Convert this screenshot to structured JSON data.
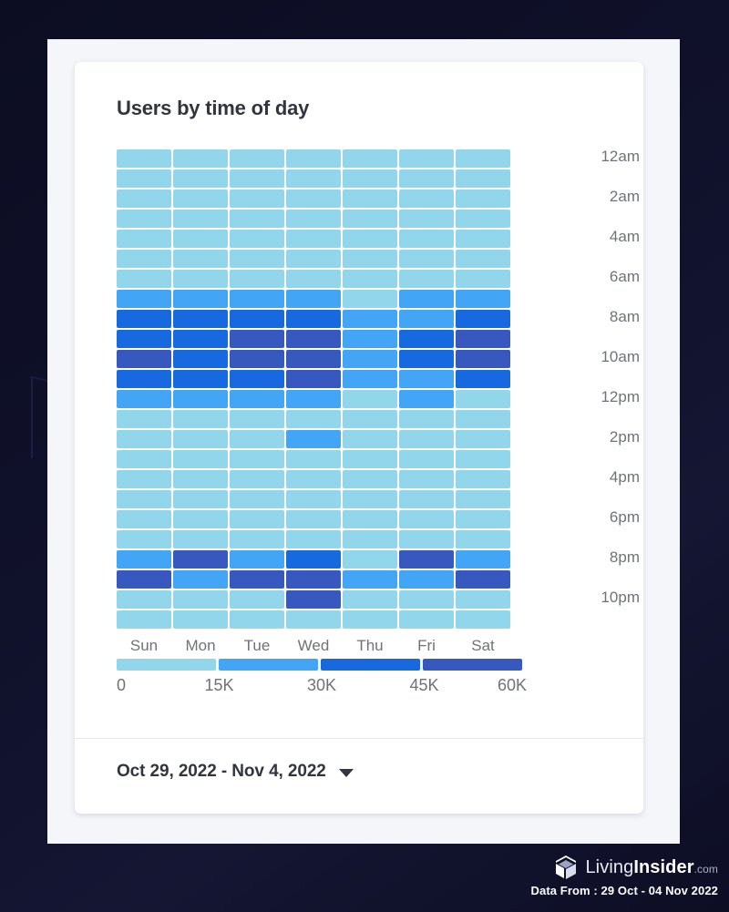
{
  "card": {
    "title": "Users by time of day",
    "date_range_label": "Oct 29, 2022 - Nov 4, 2022",
    "caret_icon": "chevron-down-icon"
  },
  "watermark": {
    "logo_icon": "isometric-house-logo-icon",
    "brand_first": "Living",
    "brand_second": "Insider",
    "brand_tld": ".com",
    "data_from": "Data From : 29 Oct - 04 Nov 2022"
  },
  "legend": {
    "colors": [
      "#92d6ec",
      "#42a5f5",
      "#1769e0",
      "#3658bf"
    ],
    "ticks": [
      "0",
      "15K",
      "30K",
      "45K",
      "60K"
    ],
    "tick_positions_pct": [
      0,
      25,
      50,
      75,
      100
    ]
  },
  "chart_data": {
    "type": "heatmap",
    "title": "Users by time of day",
    "xlabel": "",
    "ylabel": "",
    "legend_position": "bottom",
    "grid": false,
    "value_unit": "users",
    "colorbar": {
      "min": 0,
      "max": 60000,
      "ticks": [
        0,
        15000,
        30000,
        45000,
        60000
      ],
      "tick_labels": [
        "0",
        "15K",
        "30K",
        "45K",
        "60K"
      ],
      "bands": [
        {
          "range": [
            0,
            15000
          ],
          "color": "#92d6ec"
        },
        {
          "range": [
            15000,
            30000
          ],
          "color": "#42a5f5"
        },
        {
          "range": [
            30000,
            45000
          ],
          "color": "#1769e0"
        },
        {
          "range": [
            45000,
            60000
          ],
          "color": "#3658bf"
        }
      ]
    },
    "x": [
      "Sun",
      "Mon",
      "Tue",
      "Wed",
      "Thu",
      "Fri",
      "Sat"
    ],
    "x_tick_labels": [
      "Sun",
      "Mon",
      "Tue",
      "Wed",
      "Thu",
      "Fri",
      "Sat"
    ],
    "y": [
      "12am",
      "1am",
      "2am",
      "3am",
      "4am",
      "5am",
      "6am",
      "7am",
      "8am",
      "9am",
      "10am",
      "11am",
      "12pm",
      "1pm",
      "2pm",
      "3pm",
      "4pm",
      "5pm",
      "6pm",
      "7pm",
      "8pm",
      "9pm",
      "10pm",
      "11pm"
    ],
    "y_tick_labels": [
      "12am",
      "2am",
      "4am",
      "6am",
      "8am",
      "10am",
      "12pm",
      "2pm",
      "4pm",
      "6pm",
      "8pm",
      "10pm"
    ],
    "y_tick_rows": [
      0,
      2,
      4,
      6,
      8,
      10,
      12,
      14,
      16,
      18,
      20,
      22
    ],
    "values": [
      [
        5000,
        5000,
        5000,
        5000,
        5000,
        5000,
        5000
      ],
      [
        4000,
        4000,
        4000,
        4000,
        4000,
        4000,
        4000
      ],
      [
        3500,
        3500,
        3500,
        3500,
        3500,
        3500,
        3500
      ],
      [
        3500,
        3500,
        3500,
        3500,
        3500,
        3500,
        3500
      ],
      [
        4000,
        4000,
        4000,
        4000,
        4000,
        4000,
        4000
      ],
      [
        6000,
        6000,
        6000,
        6000,
        6000,
        6000,
        6000
      ],
      [
        11000,
        11000,
        11000,
        11000,
        11000,
        11000,
        11000
      ],
      [
        24000,
        24000,
        24000,
        23000,
        13000,
        23000,
        23000
      ],
      [
        38000,
        38000,
        37000,
        38000,
        26000,
        25000,
        37000
      ],
      [
        38000,
        37000,
        48000,
        49000,
        27000,
        37000,
        50000
      ],
      [
        50000,
        36000,
        50000,
        50000,
        26000,
        38000,
        51000
      ],
      [
        37000,
        36000,
        36000,
        49000,
        25000,
        24000,
        38000
      ],
      [
        24000,
        23000,
        23000,
        24000,
        13000,
        24000,
        12000
      ],
      [
        11000,
        11000,
        11000,
        11000,
        10000,
        10000,
        10000
      ],
      [
        10000,
        10000,
        10000,
        25000,
        9000,
        9000,
        9000
      ],
      [
        9000,
        9000,
        9000,
        9000,
        9000,
        9000,
        9000
      ],
      [
        8500,
        8500,
        8500,
        8500,
        8500,
        8500,
        8500
      ],
      [
        8500,
        8500,
        8500,
        8500,
        8500,
        8500,
        8500
      ],
      [
        9000,
        9000,
        9000,
        9000,
        9000,
        9000,
        9000
      ],
      [
        10000,
        10000,
        10000,
        10000,
        10000,
        10000,
        10000
      ],
      [
        24000,
        49000,
        24000,
        37000,
        12000,
        50000,
        23000
      ],
      [
        50000,
        24000,
        49000,
        49000,
        25000,
        24000,
        51000
      ],
      [
        12000,
        12000,
        12000,
        49000,
        11000,
        11000,
        11000
      ],
      [
        9000,
        9000,
        9000,
        9000,
        9000,
        9000,
        9000
      ]
    ]
  }
}
